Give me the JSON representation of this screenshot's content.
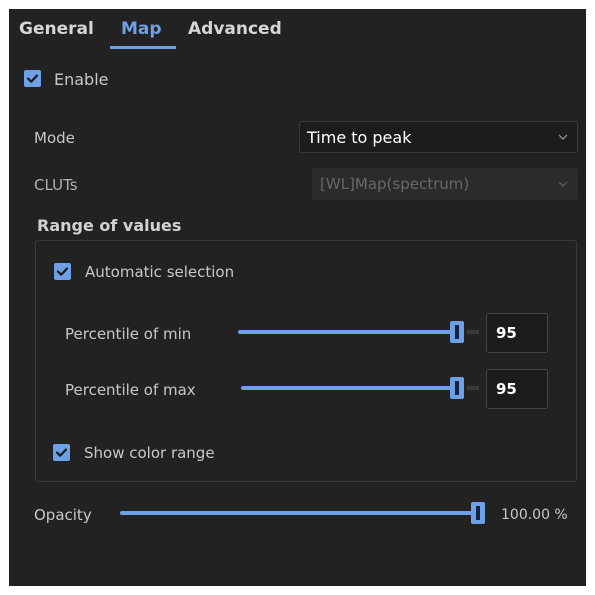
{
  "tabs": [
    {
      "label": "General",
      "active": false
    },
    {
      "label": "Map",
      "active": true
    },
    {
      "label": "Advanced",
      "active": false
    }
  ],
  "enable": {
    "label": "Enable",
    "checked": true
  },
  "mode": {
    "label": "Mode",
    "value": "Time to peak"
  },
  "cluts": {
    "label": "CLUTs",
    "value": "[WL]Map(spectrum)",
    "disabled": true
  },
  "range_of_values": {
    "title": "Range of values",
    "automatic_selection": {
      "label": "Automatic selection",
      "checked": true
    },
    "percentile_min": {
      "label": "Percentile of min",
      "value": "95",
      "fraction": 0.95
    },
    "percentile_max": {
      "label": "Percentile of max",
      "value": "95",
      "fraction": 0.95
    },
    "show_color_range": {
      "label": "Show color range",
      "checked": true
    }
  },
  "opacity": {
    "label": "Opacity",
    "value_text": "100.00 %",
    "fraction": 1.0
  },
  "colors": {
    "background": "#222222",
    "accent": "#6ea0e8",
    "text": "#c8c8c8",
    "disabled_text": "#686868"
  }
}
